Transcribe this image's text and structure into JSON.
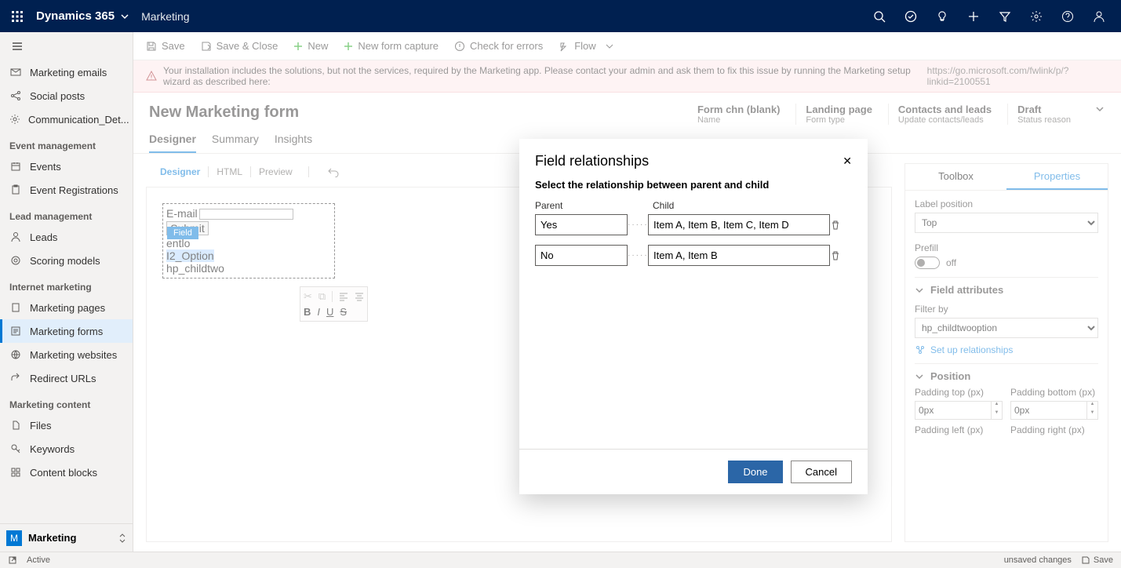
{
  "topbar": {
    "product": "Dynamics 365",
    "app": "Marketing"
  },
  "sidebar": {
    "group1": [
      {
        "icon": "mail",
        "label": "Marketing emails"
      },
      {
        "icon": "share",
        "label": "Social posts"
      },
      {
        "icon": "gear",
        "label": "Communication_Det..."
      }
    ],
    "head1": "Event management",
    "group2": [
      {
        "icon": "cal",
        "label": "Events"
      },
      {
        "icon": "clip",
        "label": "Event Registrations"
      }
    ],
    "head2": "Lead management",
    "group3": [
      {
        "icon": "person",
        "label": "Leads"
      },
      {
        "icon": "target",
        "label": "Scoring models"
      }
    ],
    "head3": "Internet marketing",
    "group4": [
      {
        "icon": "page",
        "label": "Marketing pages"
      },
      {
        "icon": "form",
        "label": "Marketing forms",
        "active": true
      },
      {
        "icon": "globe",
        "label": "Marketing websites"
      },
      {
        "icon": "redir",
        "label": "Redirect URLs"
      }
    ],
    "head4": "Marketing content",
    "group5": [
      {
        "icon": "file",
        "label": "Files"
      },
      {
        "icon": "key",
        "label": "Keywords"
      },
      {
        "icon": "block",
        "label": "Content blocks"
      }
    ],
    "switcher": {
      "badge": "M",
      "label": "Marketing"
    }
  },
  "cmdbar": {
    "save": "Save",
    "saveclose": "Save & Close",
    "new": "New",
    "newform": "New form capture",
    "check": "Check for errors",
    "flow": "Flow"
  },
  "warning": {
    "text": "Your installation includes the solutions, but not the services, required by the Marketing app. Please contact your admin and ask them to fix this issue by running the Marketing setup wizard as described here:",
    "link": "https://go.microsoft.com/fwlink/p/?linkid=2100551"
  },
  "header": {
    "title": "New Marketing form",
    "meta": [
      {
        "value": "Form chn (blank)",
        "label": "Name"
      },
      {
        "value": "Landing page",
        "label": "Form type"
      },
      {
        "value": "Contacts and leads",
        "label": "Update contacts/leads"
      },
      {
        "value": "Draft",
        "label": "Status reason"
      }
    ]
  },
  "tabs": [
    "Designer",
    "Summary",
    "Insights"
  ],
  "subtabs": [
    "Designer",
    "HTML",
    "Preview"
  ],
  "canvas": {
    "l1": "E-mail",
    "btn": "Submit",
    "badge": "Field",
    "l2": "entlo",
    "l3": "I2_Option",
    "l4": "hp_childtwo"
  },
  "proppanel": {
    "tabs": [
      "Toolbox",
      "Properties"
    ],
    "labelpos": {
      "label": "Label position",
      "value": "Top"
    },
    "prefill": {
      "label": "Prefill",
      "state": "off"
    },
    "sec1": "Field attributes",
    "filter": {
      "label": "Filter by",
      "value": "hp_childtwooption"
    },
    "link": "Set up relationships",
    "sec2": "Position",
    "pads": {
      "pt": "Padding top (px)",
      "pb": "Padding bottom (px)",
      "pl": "Padding left (px)",
      "pr": "Padding right (px)",
      "v": "0px"
    }
  },
  "status": {
    "state": "Active",
    "unsaved": "unsaved changes",
    "save": "Save"
  },
  "dialog": {
    "title": "Field relationships",
    "subtitle": "Select the relationship between parent and child",
    "cols": {
      "parent": "Parent",
      "child": "Child"
    },
    "rows": [
      {
        "parent": "Yes",
        "child": "Item A, Item B, Item C, Item D"
      },
      {
        "parent": "No",
        "child": "Item A, Item B"
      }
    ],
    "done": "Done",
    "cancel": "Cancel"
  }
}
